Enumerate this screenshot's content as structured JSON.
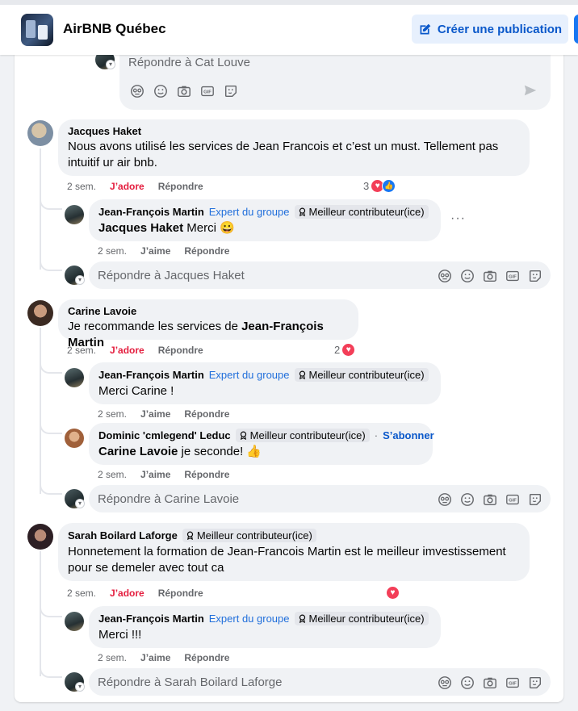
{
  "header": {
    "group_name": "AirBNB Québec",
    "create_post_label": "Créer une publication"
  },
  "top_reply": {
    "placeholder": "Répondre à Cat Louve"
  },
  "labels": {
    "expert": "Expert du groupe",
    "top_contributor": "Meilleur contributeur(ice)",
    "love": "J’adore",
    "like": "J’aime",
    "reply": "Répondre",
    "follow": "S’abonner",
    "dot": "·"
  },
  "threads": [
    {
      "author": "Jacques Haket",
      "text": "Nous avons utilisé les services de Jean Francois et c’est un must. Tellement pas intuitif ur air bnb.",
      "time": "2 sem.",
      "reaction_count": "3",
      "reply": {
        "author": "Jean-François Martin",
        "mention": "Jacques Haket",
        "text": "Merci 😀",
        "time": "2 sem."
      },
      "reply_placeholder": "Répondre à Jacques Haket"
    },
    {
      "author": "Carine Lavoie",
      "text": "Je recommande les services de ",
      "text_bold": "Jean-François Martin",
      "time": "2 sem.",
      "reaction_count": "2",
      "reply": {
        "author": "Jean-François Martin",
        "text": "Merci Carine !",
        "time": "2 sem."
      },
      "reply2": {
        "author": "Dominic 'cmlegend' Leduc",
        "mention": "Carine Lavoie",
        "text": "je seconde! 👍",
        "time": "2 sem."
      },
      "reply_placeholder": "Répondre à Carine Lavoie"
    },
    {
      "author": "Sarah Boilard Laforge",
      "text": "Honnetement la formation de Jean-Francois Martin est le meilleur imvestissement pour se demeler avec tout ca",
      "time": "2 sem.",
      "reply": {
        "author": "Jean-François Martin",
        "text": "Merci !!!",
        "time": "2 sem."
      },
      "reply_placeholder": "Répondre à Sarah Boilard Laforge"
    }
  ]
}
